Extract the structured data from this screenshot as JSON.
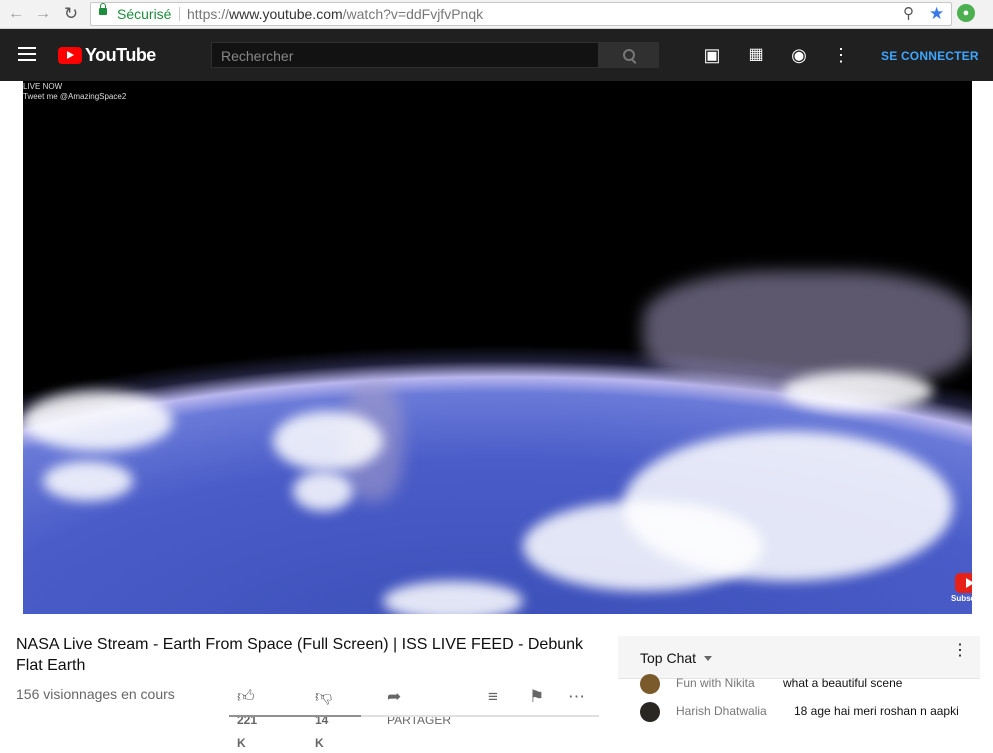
{
  "browser": {
    "secure_label": "Sécurisé",
    "url_prefix": "https://",
    "url_host": "www.youtube.com",
    "url_path": "/watch?v=ddFvjfvPnqk"
  },
  "header": {
    "logo_text": "YouTube",
    "search_placeholder": "Rechercher",
    "signin_label": "SE CONNECTER"
  },
  "video": {
    "overlay_line1": "LIVE NOW",
    "overlay_line2": "Tweet me @AmazingSpace2",
    "subscribe_label": "Subscribe"
  },
  "info": {
    "title": "NASA Live Stream - Earth From Space (Full Screen) | ISS LIVE FEED - Debunk Flat Earth",
    "views": "156 visionnages en cours",
    "likes": "221 K",
    "dislikes": "14 K",
    "share_label": "PARTAGER",
    "like_ratio": 0.94
  },
  "chat": {
    "title": "Top Chat",
    "messages": [
      {
        "author": "Fun with Nikita",
        "text": "what a beautiful scene"
      },
      {
        "author": "Harish Dhatwalia",
        "text": "18 age hai meri roshan n aapki"
      }
    ]
  },
  "colors": {
    "yt_red": "#ff0000",
    "header_bg": "#202020",
    "signin_blue": "#3ea6ff",
    "secure_green": "#1e8e3e"
  }
}
